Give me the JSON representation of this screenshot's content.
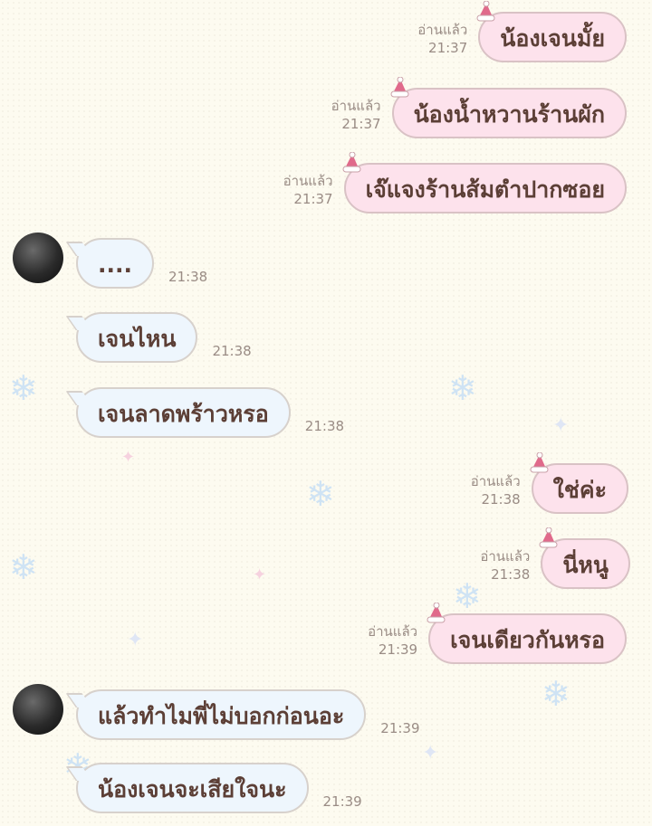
{
  "read_label": "อ่านแล้ว",
  "colors": {
    "background": "#fdfbf0",
    "outgoing_bubble": "#fde2ec",
    "incoming_bubble": "#eef6fd",
    "text": "#5c3f36",
    "meta": "#9a8c85"
  },
  "messages": [
    {
      "side": "out",
      "text": "น้องเจนมั้ย",
      "read": "อ่านแล้ว",
      "time": "21:37"
    },
    {
      "side": "out",
      "text": "น้องน้ำหวานร้านผัก",
      "read": "อ่านแล้ว",
      "time": "21:37"
    },
    {
      "side": "out",
      "text": "เจ๊แจงร้านส้มตำปากซอย",
      "read": "อ่านแล้ว",
      "time": "21:37"
    },
    {
      "side": "in",
      "text": "....",
      "time": "21:38"
    },
    {
      "side": "in",
      "text": "เจนไหน",
      "time": "21:38"
    },
    {
      "side": "in",
      "text": "เจนลาดพร้าวหรอ",
      "time": "21:38"
    },
    {
      "side": "out",
      "text": "ใช่ค่ะ",
      "read": "อ่านแล้ว",
      "time": "21:38"
    },
    {
      "side": "out",
      "text": "นี่หนู",
      "read": "อ่านแล้ว",
      "time": "21:38"
    },
    {
      "side": "out",
      "text": "เจนเดียวกันหรอ",
      "read": "อ่านแล้ว",
      "time": "21:39"
    },
    {
      "side": "in",
      "text": "แล้วทำไมพี่ไม่บอกก่อนอะ",
      "time": "21:39"
    },
    {
      "side": "in",
      "text": "น้องเจนจะเสียใจนะ",
      "time": "21:39"
    }
  ]
}
